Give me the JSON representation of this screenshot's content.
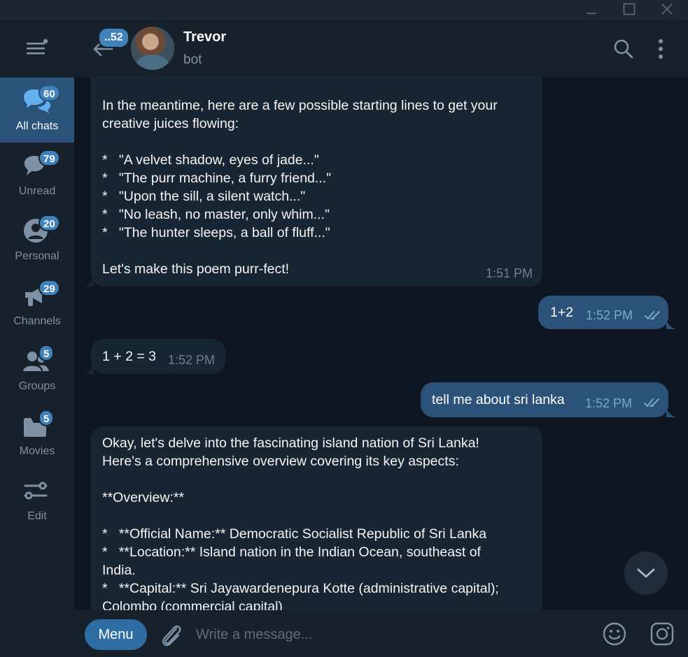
{
  "window": {
    "minimize_icon": "minimize-icon",
    "maximize_icon": "maximize-icon",
    "close_icon": "close-icon"
  },
  "sidebar": {
    "menu_icon": "hamburger-menu-icon",
    "folders": [
      {
        "label": "All chats",
        "badge": "60",
        "icon": "chats-icon",
        "active": true
      },
      {
        "label": "Unread",
        "badge": "79",
        "icon": "chat-bubble-icon"
      },
      {
        "label": "Personal",
        "badge": "20",
        "icon": "person-icon"
      },
      {
        "label": "Channels",
        "badge": "29",
        "icon": "megaphone-icon"
      },
      {
        "label": "Groups",
        "badge": "5",
        "icon": "group-icon"
      },
      {
        "label": "Movies",
        "badge": "5",
        "icon": "folder-icon"
      },
      {
        "label": "Edit",
        "icon": "sliders-icon"
      }
    ]
  },
  "header": {
    "back_badge": "..52",
    "chat_name": "Trevor",
    "chat_status": "bot",
    "search_icon": "search-icon",
    "more_icon": "more-vertical-icon"
  },
  "messages": [
    {
      "direction": "in",
      "text": "In the meantime, here are a few possible starting lines to get your\ncreative juices flowing:\n\n*   \"A velvet shadow, eyes of jade...\"\n*   \"The purr machine, a furry friend...\"\n*   \"Upon the sill, a silent watch...\"\n*   \"No leash, no master, only whim...\"\n*   \"The hunter sleeps, a ball of fluff...\"\n\nLet's make this poem purr-fect!",
      "time": "1:51 PM"
    },
    {
      "direction": "out",
      "text": "1+2",
      "time": "1:52 PM",
      "read": true
    },
    {
      "direction": "in",
      "text": "1 + 2 = 3",
      "time": "1:52 PM"
    },
    {
      "direction": "out",
      "text": "tell me about sri lanka",
      "time": "1:52 PM",
      "read": true
    },
    {
      "direction": "in",
      "text": "Okay, let's delve into the fascinating island nation of Sri Lanka!\nHere's a comprehensive overview covering its key aspects:\n\n**Overview:**\n\n*   **Official Name:** Democratic Socialist Republic of Sri Lanka\n*   **Location:** Island nation in the Indian Ocean, southeast of\nIndia.\n*   **Capital:** Sri Jayawardenepura Kotte (administrative capital);\nColombo (commercial capital)"
    }
  ],
  "composer": {
    "menu_label": "Menu",
    "placeholder": "Write a message...",
    "attach_icon": "paperclip-icon",
    "emoji_icon": "emoji-icon",
    "camera_icon": "instagram-camera-icon"
  },
  "colors": {
    "background": "#0e1621",
    "panel": "#17212b",
    "incoming_bubble": "#182533",
    "outgoing_bubble": "#2b5278",
    "accent": "#4082bc"
  }
}
